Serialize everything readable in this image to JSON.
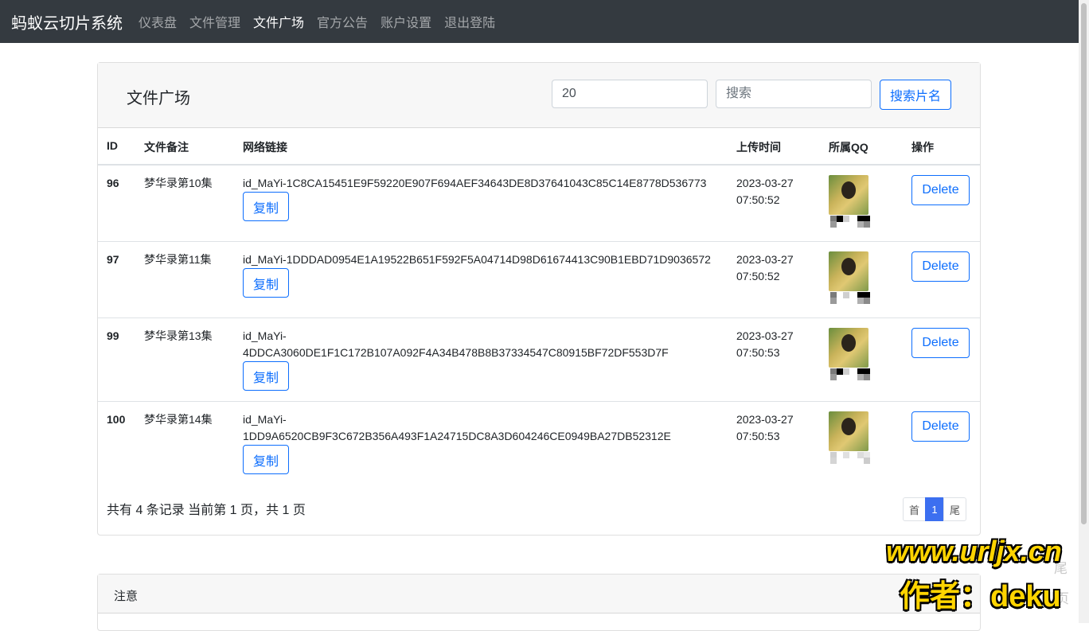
{
  "navbar": {
    "brand": "蚂蚁云切片系统",
    "links": [
      "仪表盘",
      "文件管理",
      "文件广场",
      "官方公告",
      "账户设置",
      "退出登陆"
    ],
    "active_index": 2
  },
  "page": {
    "title": "文件广场",
    "limit_value": "20",
    "search_placeholder": "搜索",
    "search_button": "搜索片名"
  },
  "table": {
    "headers": [
      "ID",
      "文件备注",
      "网络链接",
      "上传时间",
      "所属QQ",
      "操作"
    ],
    "copy_label": "复制",
    "delete_label": "Delete",
    "rows": [
      {
        "id": "96",
        "note": "梦华录第10集",
        "link_1": "id_MaYi-1C8CA15451E9F59220E907F694AEF34643DE8D37641043C85C14E8778D536773",
        "link_2": "",
        "date": "2023-03-27",
        "time": "07:50:52"
      },
      {
        "id": "97",
        "note": "梦华录第11集",
        "link_1": "id_MaYi-1DDDAD0954E1A19522B651F592F5A04714D98D61674413C90B1EBD71D9036572",
        "link_2": "",
        "date": "2023-03-27",
        "time": "07:50:52"
      },
      {
        "id": "99",
        "note": "梦华录第13集",
        "link_1": "id_MaYi-",
        "link_2": "4DDCA3060DE1F1C172B107A092F4A34B478B8B37334547C80915BF72DF553D7F",
        "date": "2023-03-27",
        "time": "07:50:53"
      },
      {
        "id": "100",
        "note": "梦华录第14集",
        "link_1": "id_MaYi-",
        "link_2": "1DD9A6520CB9F3C672B356A493F1A24715DC8A3D604246CE0949BA27DB52312E",
        "date": "2023-03-27",
        "time": "07:50:53"
      }
    ]
  },
  "footer": {
    "summary": "共有 4 条记录 当前第 1 页，共 1 页",
    "pager": [
      "首",
      "1",
      "尾"
    ],
    "current_page": 1
  },
  "notice": {
    "title": "注意"
  },
  "watermark": {
    "line1": "www.urljx.cn",
    "line2": "作者：deku",
    "ghost_1": "尾",
    "ghost_2": "页"
  },
  "colors": {
    "navbar": "#343a40",
    "primary": "#0d6efd",
    "pager_active": "#3c6ff0",
    "watermark": "#ffd400"
  }
}
